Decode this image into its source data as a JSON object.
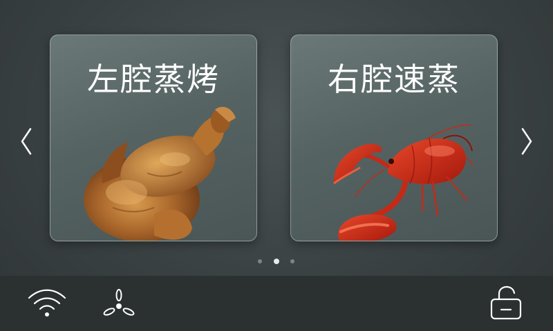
{
  "cards": [
    {
      "title": "左腔蒸烤",
      "food_icon": "roast-chicken"
    },
    {
      "title": "右腔速蒸",
      "food_icon": "red-lobster"
    }
  ],
  "pagination": {
    "page_count": 3,
    "active_index": 1
  },
  "navigation": {
    "prev_icon": "chevron-left-icon",
    "next_icon": "chevron-right-icon"
  },
  "status_bar": {
    "icons": [
      "wifi-icon",
      "fan-icon",
      "unlock-icon"
    ]
  },
  "colors": {
    "background": "#3a4142",
    "card": "#566363",
    "bottom_bar": "#2b3031",
    "text": "#ffffff"
  }
}
